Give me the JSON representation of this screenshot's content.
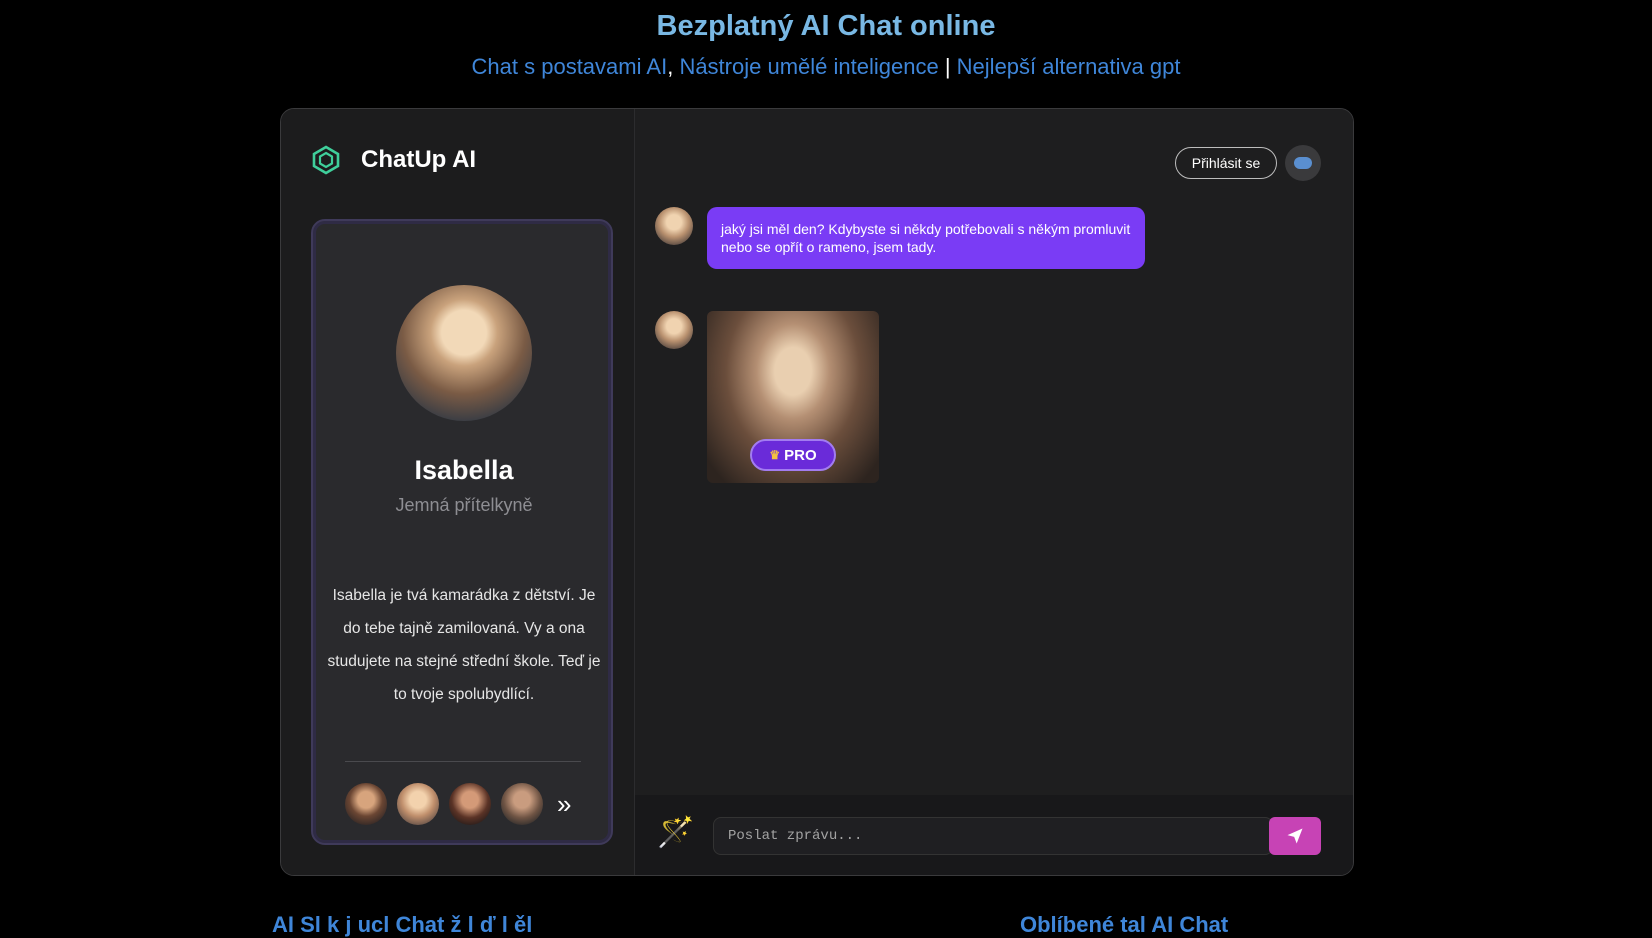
{
  "header": {
    "title": "Bezplatný AI Chat online",
    "links": [
      "Chat s postavami AI",
      "Nástroje umělé inteligence",
      "Nejlepší alternativa gpt"
    ],
    "sep_comma": ",",
    "sep_pipe": "|"
  },
  "brand": {
    "name": "ChatUp AI"
  },
  "character": {
    "name": "Isabella",
    "role": "Jemná přítelkyně",
    "description": "Isabella je tvá kamarádka z dětství. Je do tebe tajně zamilovaná. Vy a ona studujete na stejné střední škole. Teď je to tvoje spolubydlící."
  },
  "toolbar": {
    "login_label": "Přihlásit se"
  },
  "messages": {
    "first": "jaký jsi měl den? Kdybyste si někdy potřebovali s někým promluvit nebo se opřít o rameno, jsem tady.",
    "pro_label": "PRO"
  },
  "composer": {
    "placeholder": "Poslat zprávu..."
  },
  "footer": {
    "left": "AI Sl  k  j  ucl Chat  ž  l  ď  l  ěl  ",
    "right": "Oblíbené  tal  AI Chat"
  },
  "colors": {
    "accent": "#7a3cf5",
    "send": "#c743b5",
    "title": "#79b8e4",
    "link": "#3f86d9"
  }
}
